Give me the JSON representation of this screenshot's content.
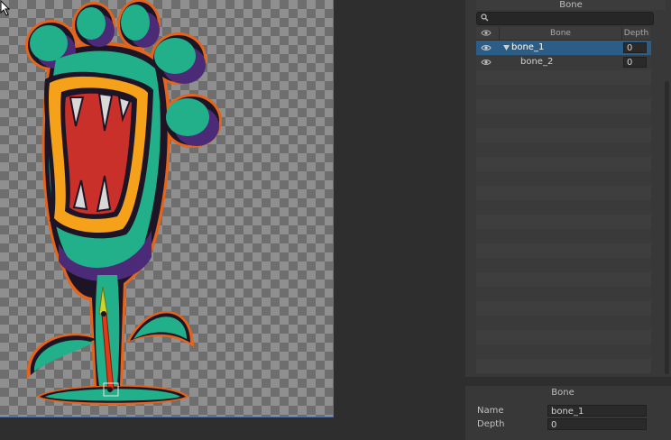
{
  "bone_panel": {
    "title": "Bone",
    "search": {
      "placeholder": "",
      "value": ""
    },
    "columns": {
      "visibility": "eye-icon",
      "bone": "Bone",
      "depth": "Depth"
    },
    "rows": [
      {
        "name": "bone_1",
        "depth": "0",
        "selected": true,
        "expanded": true
      },
      {
        "name": "bone_2",
        "depth": "0",
        "selected": false
      }
    ]
  },
  "inspector": {
    "title": "Bone",
    "name_label": "Name",
    "name_value": "bone_1",
    "depth_label": "Depth",
    "depth_value": "0"
  },
  "colors": {
    "selection": "#2c5d87",
    "panel_bg": "#383838",
    "canvas_border": "#4f6fa8",
    "bone_1": "#c9d430",
    "bone_2": "#e03a18"
  }
}
